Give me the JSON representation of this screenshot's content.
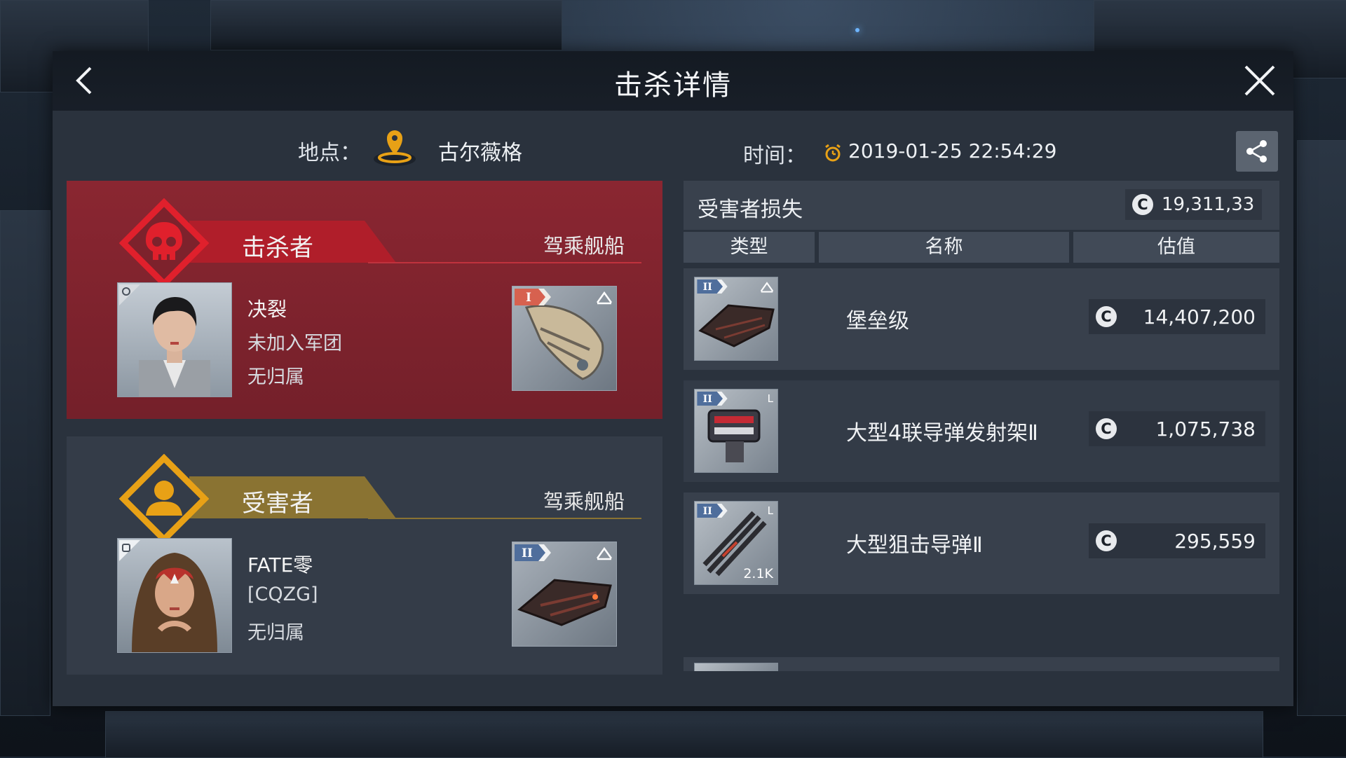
{
  "window": {
    "title": "击杀详情",
    "back_icon": "chevron-left-icon",
    "close_icon": "close-icon"
  },
  "info": {
    "location_label": "地点：",
    "location_value": "古尔薇格",
    "location_icon": "map-pin-icon",
    "time_label": "时间：",
    "time_value": "2019-01-25 22:54:29",
    "time_icon": "alarm-clock-icon",
    "share_icon": "share-icon"
  },
  "killer": {
    "role": "击杀者",
    "ship_heading": "驾乘舰船",
    "name": "决裂",
    "corp": "未加入军团",
    "alliance": "无归属",
    "ship_tier": "I",
    "badge_icon": "skull-icon",
    "accent": "#d6222f"
  },
  "victim": {
    "role": "受害者",
    "ship_heading": "驾乘舰船",
    "name": "FATE零",
    "corp": "[CQZG]",
    "alliance": "无归属",
    "ship_tier": "II",
    "badge_icon": "person-icon",
    "accent": "#e8a116"
  },
  "loss": {
    "title": "受害者损失",
    "total": "19,311,33",
    "currency_symbol": "C",
    "columns": [
      "类型",
      "名称",
      "估值"
    ],
    "items": [
      {
        "tier": "II",
        "slot": "",
        "name": "堡垒级",
        "value": "14,407,200",
        "qty": ""
      },
      {
        "tier": "II",
        "slot": "L",
        "name": "大型4联导弹发射架Ⅱ",
        "value": "1,075,738",
        "qty": ""
      },
      {
        "tier": "II",
        "slot": "L",
        "name": "大型狙击导弹Ⅱ",
        "value": "295,559",
        "qty": "2.1K"
      }
    ]
  },
  "colors": {
    "panel": "#2a323d",
    "killer_card": "#7d222c",
    "victim_card": "#343c48",
    "killer_accent": "#d6222f",
    "victim_accent": "#e8a116"
  }
}
